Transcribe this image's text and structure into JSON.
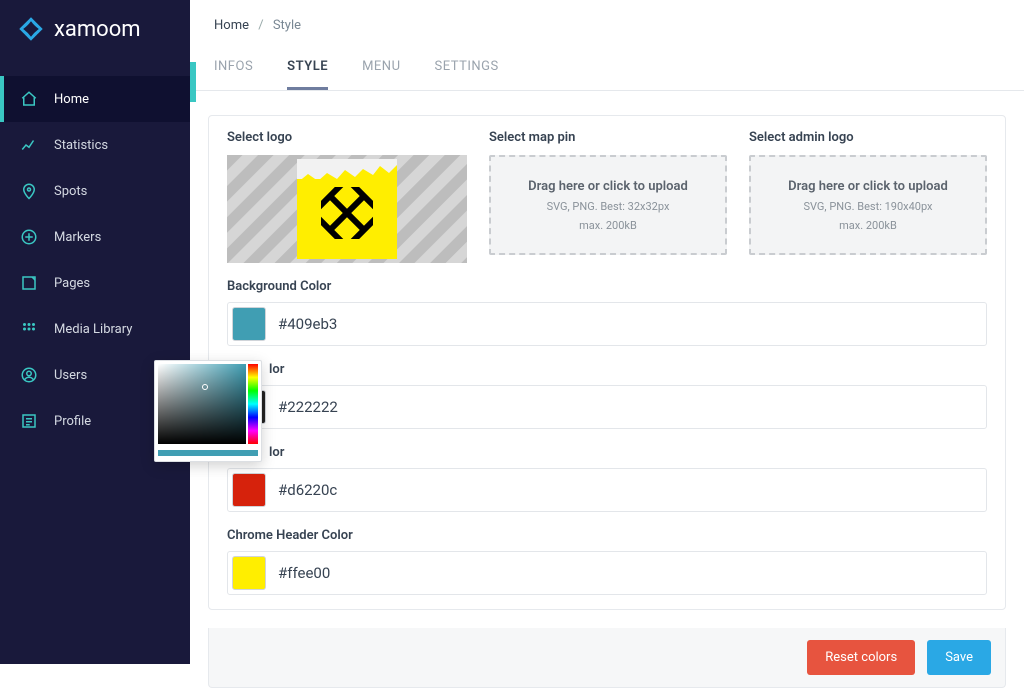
{
  "brand": "xamoom",
  "sidebar": {
    "items": [
      {
        "label": "Home",
        "active": true
      },
      {
        "label": "Statistics"
      },
      {
        "label": "Spots"
      },
      {
        "label": "Markers"
      },
      {
        "label": "Pages"
      },
      {
        "label": "Media Library"
      },
      {
        "label": "Users"
      },
      {
        "label": "Profile"
      }
    ]
  },
  "breadcrumbs": {
    "root": "Home",
    "current": "Style",
    "sep": "/"
  },
  "tabs": {
    "infos": "INFOS",
    "style": "STYLE",
    "menu": "MENU",
    "settings": "SETTINGS"
  },
  "uploads": {
    "logo": {
      "title": "Select logo"
    },
    "map_pin": {
      "title": "Select map pin",
      "line1": "Drag here or click to upload",
      "line2": "SVG, PNG. Best: 32x32px",
      "line3": "max. 200kB"
    },
    "admin": {
      "title": "Select admin logo",
      "line1": "Drag here or click to upload",
      "line2": "SVG, PNG. Best: 190x40px",
      "line3": "max. 200kB"
    }
  },
  "colors": {
    "bg": {
      "label": "Background Color",
      "value": "#409eb3",
      "swatch": "#409eb3"
    },
    "fg": {
      "label_suffix": "lor",
      "value": "#222222",
      "swatch": "#222222"
    },
    "hl": {
      "label_suffix": "lor",
      "value": "#d6220c",
      "swatch": "#d6220c"
    },
    "chrome": {
      "label": "Chrome Header Color",
      "value": "#ffee00",
      "swatch": "#ffee00"
    }
  },
  "buttons": {
    "reset": "Reset colors",
    "save": "Save"
  }
}
